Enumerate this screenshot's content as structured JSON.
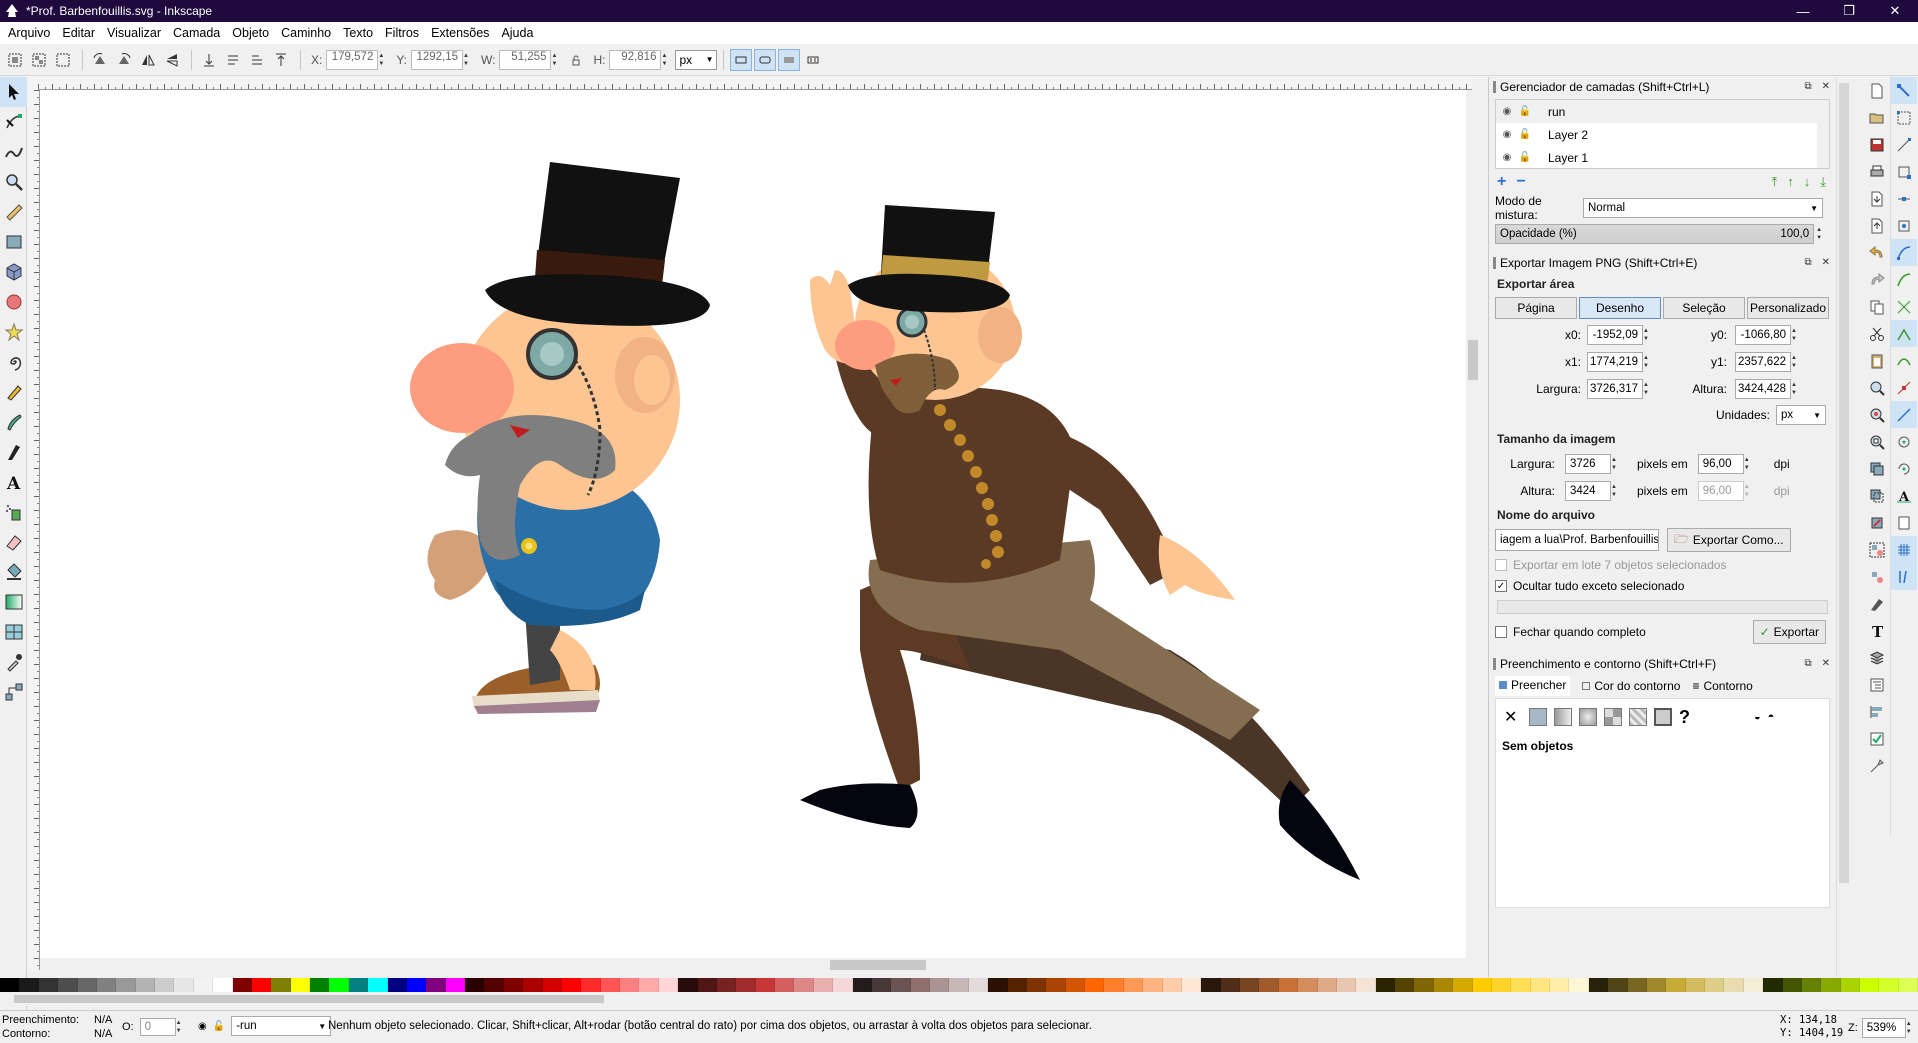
{
  "window": {
    "title": "*Prof. Barbenfouillis.svg - Inkscape",
    "minimize": "—",
    "maximize": "❐",
    "close": "✕"
  },
  "menu": [
    "Arquivo",
    "Editar",
    "Visualizar",
    "Camada",
    "Objeto",
    "Caminho",
    "Texto",
    "Filtros",
    "Extensões",
    "Ajuda"
  ],
  "toolbar": {
    "x_label": "X:",
    "x_value": "179,572",
    "y_label": "Y:",
    "y_value": "1292,15",
    "w_label": "W:",
    "w_value": "51,255",
    "h_label": "H:",
    "h_value": "92,816",
    "unit": "px"
  },
  "layers_panel": {
    "title": "Gerenciador de camadas (Shift+Ctrl+L)",
    "layers": [
      {
        "name": "run"
      },
      {
        "name": "Layer 2"
      },
      {
        "name": "Layer 1"
      }
    ],
    "blend_label": "Modo de mistura:",
    "blend_value": "Normal",
    "opacity_label": "Opacidade (%)",
    "opacity_value": "100,0"
  },
  "export_panel": {
    "title": "Exportar Imagem PNG (Shift+Ctrl+E)",
    "area_title": "Exportar área",
    "area_buttons": [
      "Página",
      "Desenho",
      "Seleção",
      "Personalizado"
    ],
    "active_area": "Desenho",
    "x0_label": "x0:",
    "x0": "-1952,09",
    "y0_label": "y0:",
    "y0": "-1066,80",
    "x1_label": "x1:",
    "x1": "1774,219",
    "y1_label": "y1:",
    "y1": "2357,622",
    "width_label": "Largura:",
    "width": "3726,317",
    "height_label": "Altura:",
    "height": "3424,428",
    "units_label": "Unidades:",
    "units": "px",
    "image_size_title": "Tamanho da imagem",
    "img_width_label": "Largura:",
    "img_width": "3726",
    "img_height_label": "Altura:",
    "img_height": "3424",
    "pixels_at": "pixels em",
    "dpi_x": "96,00",
    "dpi_y": "96,00",
    "dpi_label": "dpi",
    "filename_title": "Nome do arquivo",
    "filename": "iagem a lua\\Prof. Barbenfouillis.png",
    "export_as": "Exportar Como...",
    "batch_label": "Exportar em lote 7 objetos selecionados",
    "hide_label": "Ocultar tudo exceto selecionado",
    "close_label": "Fechar quando completo",
    "export_button": "Exportar"
  },
  "fill_panel": {
    "title": "Preenchimento e contorno (Shift+Ctrl+F)",
    "tabs": [
      "Preencher",
      "Cor do contorno",
      "Contorno"
    ],
    "no_objects": "Sem objetos"
  },
  "status": {
    "fill_label": "Preenchimento:",
    "fill_value": "N/A",
    "stroke_label": "Contorno:",
    "stroke_value": "N/A",
    "opacity_label": "O:",
    "opacity_value": "0",
    "layer": "-run",
    "message": "Nenhum objeto selecionado. Clicar, Shift+clicar, Alt+rodar (botão central do rato) por cima dos objetos, ou arrastar à volta dos objetos para selecionar.",
    "x_coord": "X: 134,18",
    "y_coord": "Y: 1404,19",
    "zoom_label": "Z:",
    "zoom": "539%"
  },
  "palette": [
    "#000000",
    "#1a1a1a",
    "#333333",
    "#4d4d4d",
    "#666666",
    "#808080",
    "#999999",
    "#b3b3b3",
    "#cccccc",
    "#e6e6e6",
    "#f2f2f2",
    "#ffffff",
    "#800000",
    "#ff0000",
    "#808000",
    "#ffff00",
    "#008000",
    "#00ff00",
    "#008080",
    "#00ffff",
    "#000080",
    "#0000ff",
    "#800080",
    "#ff00ff",
    "#2b0000",
    "#550000",
    "#800000",
    "#aa0000",
    "#d40000",
    "#ff0000",
    "#ff2a2a",
    "#ff5555",
    "#ff8080",
    "#ffaaaa",
    "#ffd5d5",
    "#280b0b",
    "#501616",
    "#782121",
    "#a02c2c",
    "#c83737",
    "#d35f5f",
    "#de8787",
    "#e9afaf",
    "#f4d7d7",
    "#241c1c",
    "#483737",
    "#6c5353",
    "#916f6f",
    "#ac9393",
    "#c8b7b7",
    "#e3dbdb",
    "#2b1100",
    "#552200",
    "#803300",
    "#aa4400",
    "#d45500",
    "#ff6600",
    "#ff7f2a",
    "#ff9955",
    "#ffb380",
    "#ffccaa",
    "#ffe6d5",
    "#28170b",
    "#502d16",
    "#784421",
    "#a05a2c",
    "#c87137",
    "#d38d5f",
    "#deaa87",
    "#e9c6af",
    "#f4e3d7",
    "#2b2200",
    "#554400",
    "#806600",
    "#aa8800",
    "#d4aa00",
    "#ffcc00",
    "#ffd42a",
    "#ffdd55",
    "#ffe680",
    "#ffeeaa",
    "#fff6d5",
    "#28220b",
    "#504416",
    "#786721",
    "#a0892c",
    "#c8ab37",
    "#d3bc5f",
    "#decd87",
    "#e9ddaf",
    "#f4eed7",
    "#222b00",
    "#445500",
    "#668000",
    "#88aa00",
    "#aad400",
    "#ccff00",
    "#d4ff2a",
    "#ddff55"
  ],
  "icons": {
    "tools": [
      "selector-icon",
      "node-icon",
      "tweak-icon",
      "zoom-icon",
      "measure-icon",
      "rect-icon",
      "3dbox-icon",
      "ellipse-icon",
      "star-icon",
      "spiral-icon",
      "pencil-icon",
      "pen-icon",
      "calligraphy-icon",
      "text-icon",
      "spray-icon",
      "eraser-icon",
      "bucket-icon",
      "gradient-icon",
      "mesh-icon",
      "dropper-icon",
      "connector-icon"
    ]
  }
}
